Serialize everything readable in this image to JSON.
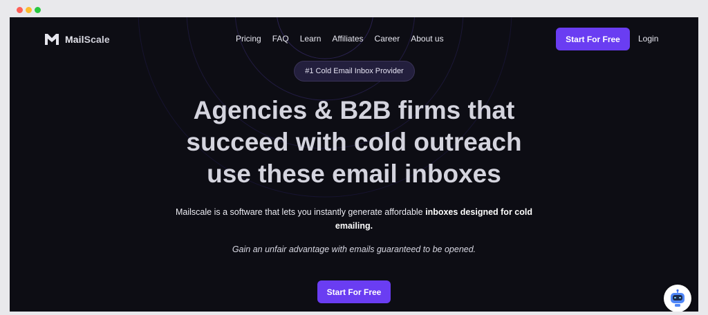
{
  "brand": {
    "name_bold": "Mail",
    "name_light": "Scale"
  },
  "nav": {
    "items": [
      "Pricing",
      "FAQ",
      "Learn",
      "Affiliates",
      "Career",
      "About us"
    ],
    "cta_label": "Start For Free",
    "login_label": "Login"
  },
  "hero": {
    "badge": "#1 Cold Email Inbox Provider",
    "headline_line1": "Agencies & B2B firms that",
    "headline_line2": "succeed with cold outreach",
    "headline_line3": "use these email inboxes",
    "sub_plain": "Mailscale is a software that lets you instantly generate affordable ",
    "sub_bold": "inboxes designed for cold emailing.",
    "tagline": "Gain an unfair advantage with emails guaranteed to be opened.",
    "cta_label": "Start For Free"
  },
  "chat_widget": {
    "icon": "robot-chat-icon"
  },
  "colors": {
    "accent": "#6a3df2",
    "background": "#0d0d14",
    "text": "#d4d4de"
  }
}
